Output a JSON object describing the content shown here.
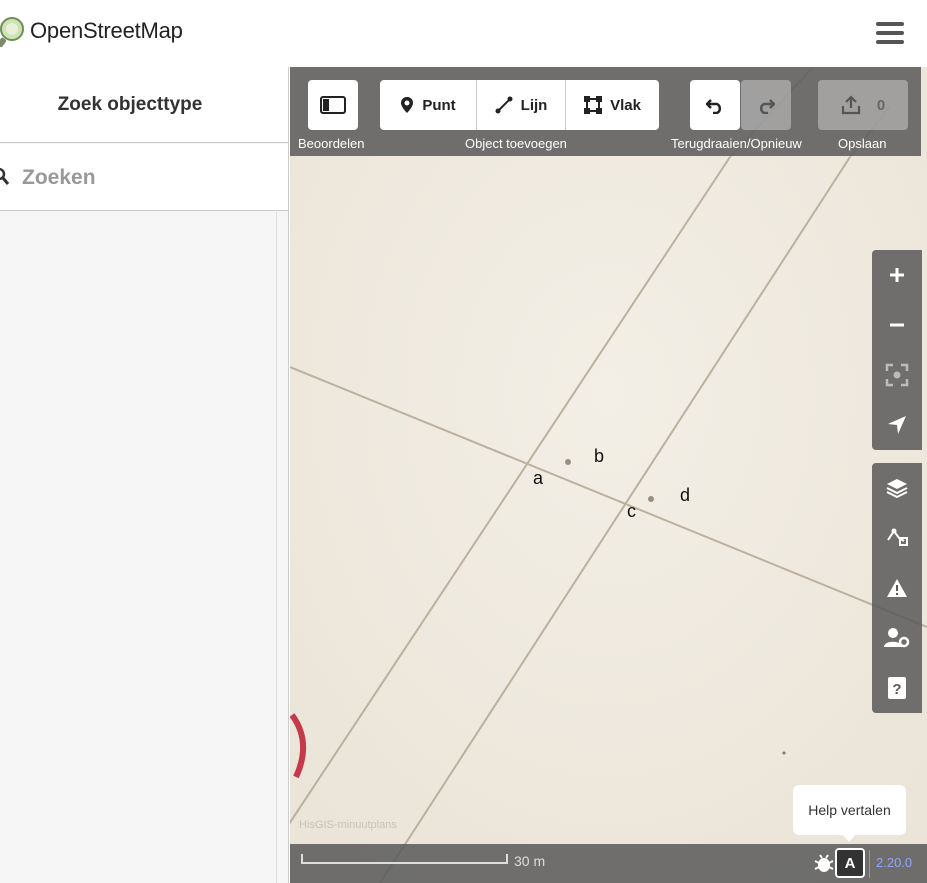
{
  "header": {
    "brand": "OpenStreetMap"
  },
  "sidebar": {
    "title": "Zoek objecttype",
    "search": {
      "placeholder": "Zoeken",
      "value": ""
    }
  },
  "toolbar": {
    "sidebar_toggle_label": "Beoordelen",
    "add_group_label": "Object toevoegen",
    "point_label": "Punt",
    "line_label": "Lijn",
    "area_label": "Vlak",
    "undo_redo_label": "Terugdraaien/Opnieuw",
    "save_label": "Opslaan",
    "save_count": "0"
  },
  "map": {
    "labels": {
      "a": "a",
      "b": "b",
      "c": "c",
      "d": "d"
    },
    "attribution": "HisGIS-minuutplans",
    "scale_label": "30 m",
    "help_tooltip": "Help vertalen",
    "version": "2.20.0"
  },
  "controls": {
    "icons": [
      "plus-icon",
      "minus-icon",
      "zoom-to-selection-icon",
      "geolocate-icon",
      "layers-icon",
      "map-data-icon",
      "issues-icon",
      "preferences-icon",
      "help-icon"
    ]
  },
  "colors": {
    "bar": "#5a5a5a",
    "map_bg": "#efe9df",
    "version": "#8ea6ff"
  }
}
